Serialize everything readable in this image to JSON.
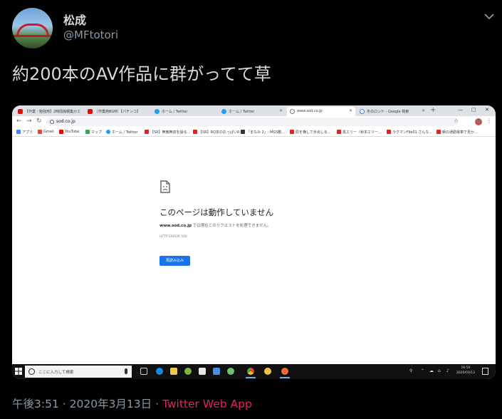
{
  "tweet": {
    "display_name": "松成",
    "handle": "@MFtotori",
    "text": "約200本のAV作品に群がってて草",
    "time": "午後3:51",
    "date": "2020年3月13日",
    "separator": "·",
    "source": "Twitter Web App"
  },
  "browser": {
    "tabs": [
      {
        "label": "【作業・勉強用】2時間煽積集かエ",
        "icon": "youtube-icon"
      },
      {
        "label": "〔作業用BGM〕【パチンコ】",
        "icon": "youtube-icon"
      },
      {
        "label": "ホーム / Twitter",
        "icon": "twitter-icon"
      },
      {
        "label": "ホーム / Twitter",
        "icon": "twitter-icon"
      },
      {
        "label": "www.sod.co.jp",
        "icon": "globe-icon",
        "active": true
      },
      {
        "label": "冬のロンド - Google 検索",
        "icon": "google-icon"
      }
    ],
    "url": "sod.co.jp",
    "bookmarks": [
      {
        "label": "アプリ",
        "color": "#4285f4"
      },
      {
        "label": "Gmail",
        "color": "#ea4335"
      },
      {
        "label": "YouTube",
        "color": "#ff0000"
      },
      {
        "label": "マップ",
        "color": "#34a853"
      },
      {
        "label": "ホーム / Twitter",
        "color": "#1da1f2"
      },
      {
        "label": "【SR】無敵無双を操る...",
        "color": "#e02424"
      },
      {
        "label": "【SR】RQ本のおっぱいR...",
        "color": "#e02424"
      },
      {
        "label": "「まなみ 2」: MGS動...",
        "color": "#333333"
      },
      {
        "label": "原を横して手出しる...",
        "color": "#e02424"
      },
      {
        "label": "黒エリー（秋本エリー...",
        "color": "#e02424"
      },
      {
        "label": "ラグマンFile01 さんな...",
        "color": "#e02424"
      },
      {
        "label": "朝の通勤電車で見か...",
        "color": "#e02424"
      }
    ]
  },
  "error_page": {
    "title": "このページは動作していません",
    "domain": "www.sod.co.jp",
    "description": " では現在このリクエストを処理できません。",
    "code": "HTTP ERROR 500",
    "reload_label": "再読み込み"
  },
  "taskbar": {
    "search_placeholder": "ここに入力して検索",
    "time": "16:50",
    "date": "2020/03/13"
  },
  "colors": {
    "background": "#000000",
    "text": "#d9d9d9",
    "muted": "#8899a6",
    "source_link": "#e0245e",
    "chrome_blue": "#1a73e8"
  }
}
